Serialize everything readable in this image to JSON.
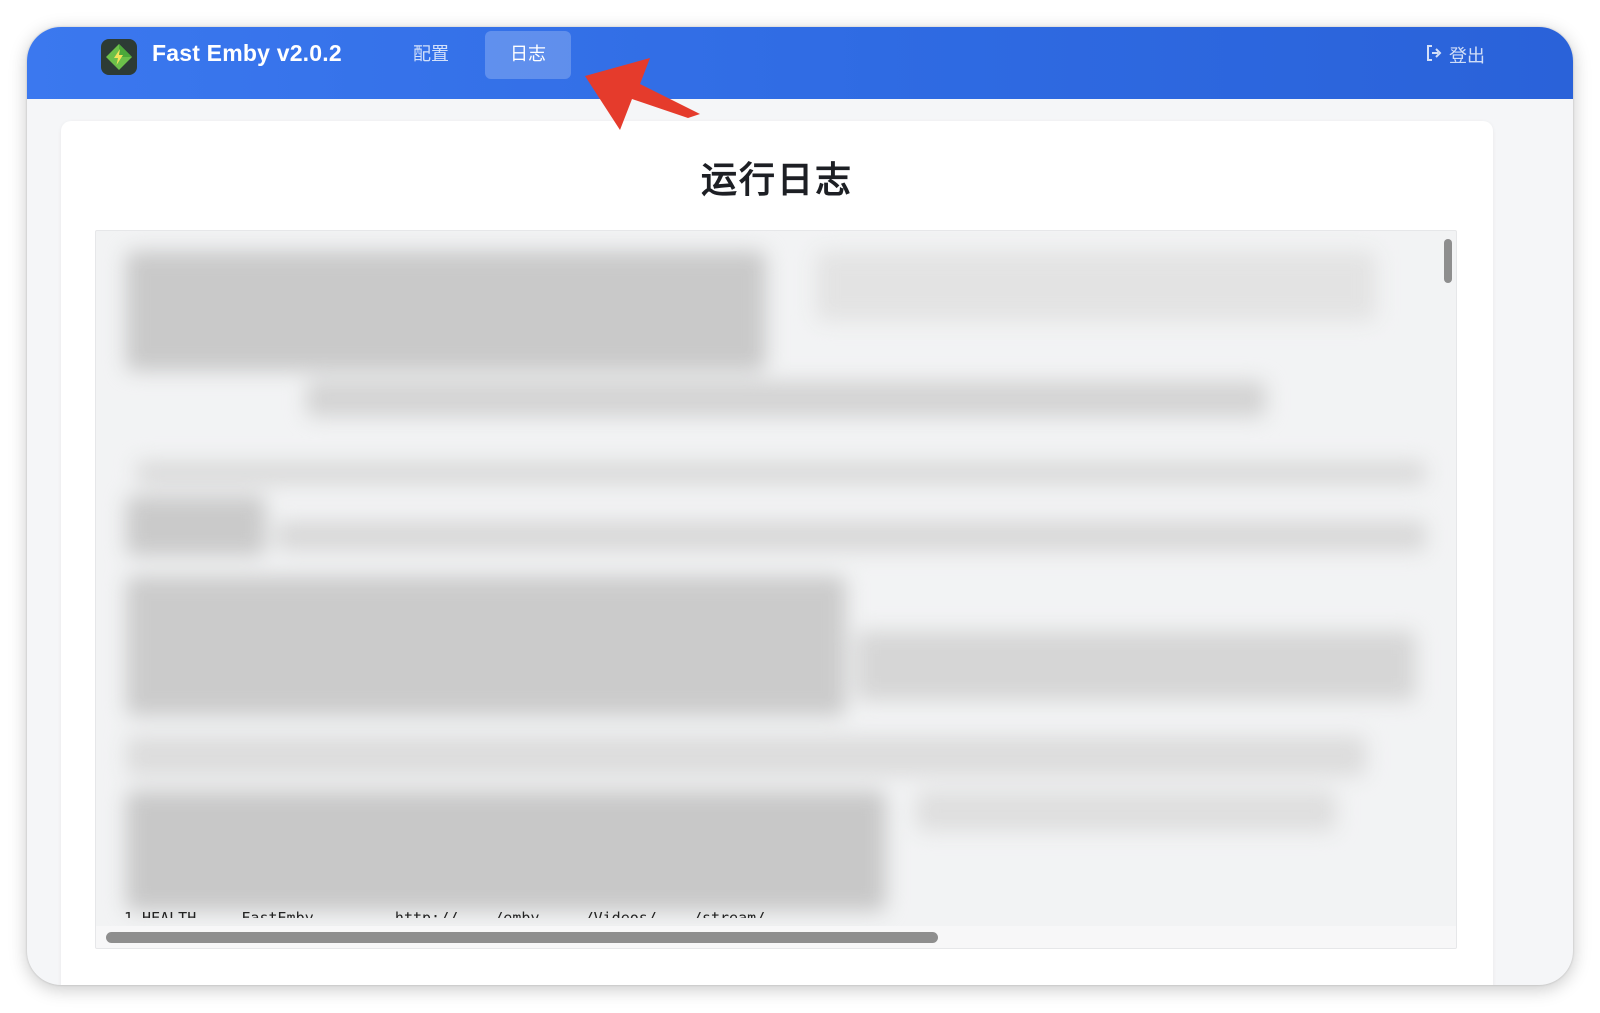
{
  "header": {
    "app_name": "Fast Emby v2.0.2",
    "nav": [
      {
        "label": "配置",
        "active": false
      },
      {
        "label": "日志",
        "active": true
      }
    ],
    "logout_label": "登出",
    "brand_color": "#3b78ef"
  },
  "main": {
    "title": "运行日志",
    "visible_log_fragment": "1 HEALTH  ... FastEmby ...  ... http://... /emby ... /Videos/... /stream/"
  },
  "annotation": {
    "arrow_color": "#e53b2c",
    "points_to": "日志"
  }
}
